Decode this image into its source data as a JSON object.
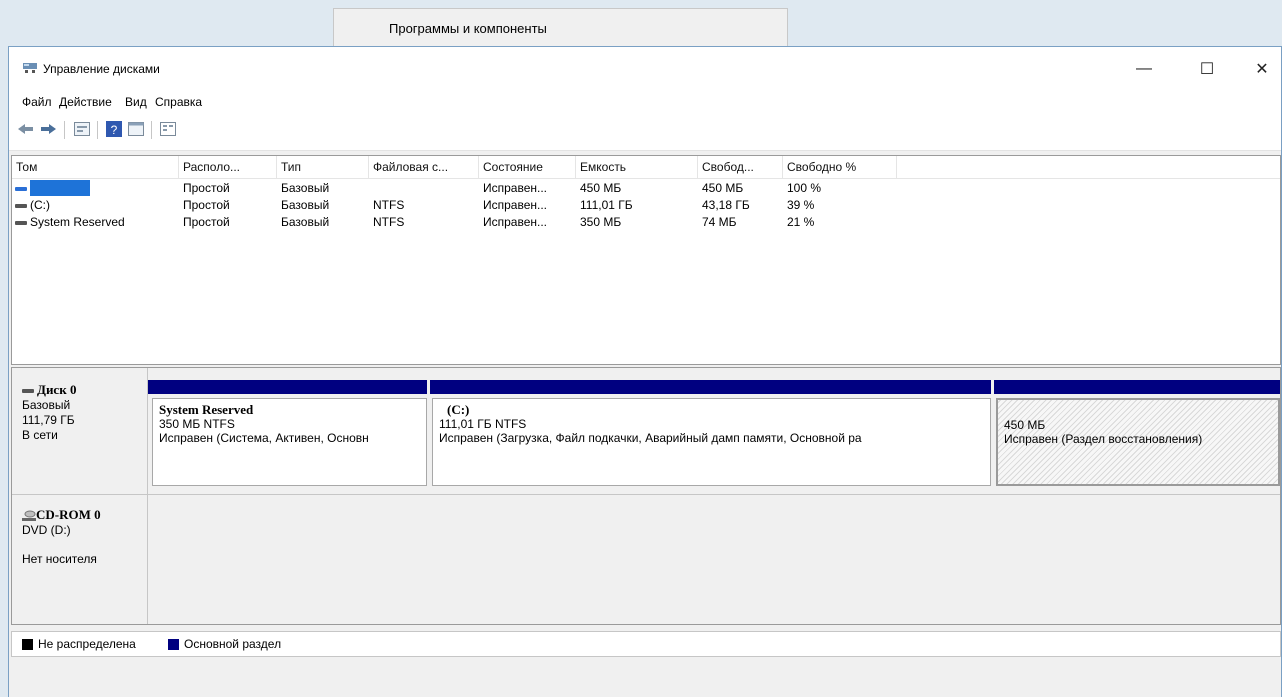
{
  "background_menu": {
    "label": "Программы и компоненты"
  },
  "window": {
    "title": "Управление дисками",
    "controls": {
      "minimize": "—",
      "maximize": "☐",
      "close": "✕"
    }
  },
  "menu": [
    "Файл",
    "Действие",
    "Вид",
    "Справка"
  ],
  "toolbar": {
    "icons": [
      "back-icon",
      "forward-icon",
      "properties-icon",
      "help-icon",
      "console-icon",
      "list-view-icon"
    ]
  },
  "volume_table": {
    "columns": [
      "Том",
      "Располо...",
      "Тип",
      "Файловая с...",
      "Состояние",
      "Емкость",
      "Свобод...",
      "Свободно %"
    ],
    "rows": [
      {
        "tom": "",
        "layout": "Простой",
        "type": "Базовый",
        "fs": "",
        "status": "Исправен...",
        "capacity": "450 МБ",
        "free": "450 МБ",
        "free_pct": "100 %"
      },
      {
        "tom": "(C:)",
        "layout": "Простой",
        "type": "Базовый",
        "fs": "NTFS",
        "status": "Исправен...",
        "capacity": "111,01 ГБ",
        "free": "43,18 ГБ",
        "free_pct": "39 %"
      },
      {
        "tom": "System Reserved",
        "layout": "Простой",
        "type": "Базовый",
        "fs": "NTFS",
        "status": "Исправен...",
        "capacity": "350 МБ",
        "free": "74 МБ",
        "free_pct": "21 %"
      }
    ]
  },
  "disks": {
    "disk0": {
      "name": "Диск 0",
      "type": "Базовый",
      "size": "111,79 ГБ",
      "state": "В сети",
      "partitions": [
        {
          "name": "System Reserved",
          "size_fs": "350 МБ NTFS",
          "status": "Исправен (Система, Активен, Основн"
        },
        {
          "name": "(C:)",
          "size_fs": "111,01 ГБ NTFS",
          "status": "Исправен (Загрузка, Файл подкачки, Аварийный дамп памяти, Основной ра"
        },
        {
          "name": "",
          "size_fs": "450 МБ",
          "status": "Исправен (Раздел восстановления)"
        }
      ]
    },
    "cdrom0": {
      "name": "CD-ROM 0",
      "drive": "DVD (D:)",
      "media": "Нет носителя"
    }
  },
  "legend": [
    {
      "label": "Не распределена",
      "color": "#000000"
    },
    {
      "label": "Основной раздел",
      "color": "#000080"
    }
  ]
}
